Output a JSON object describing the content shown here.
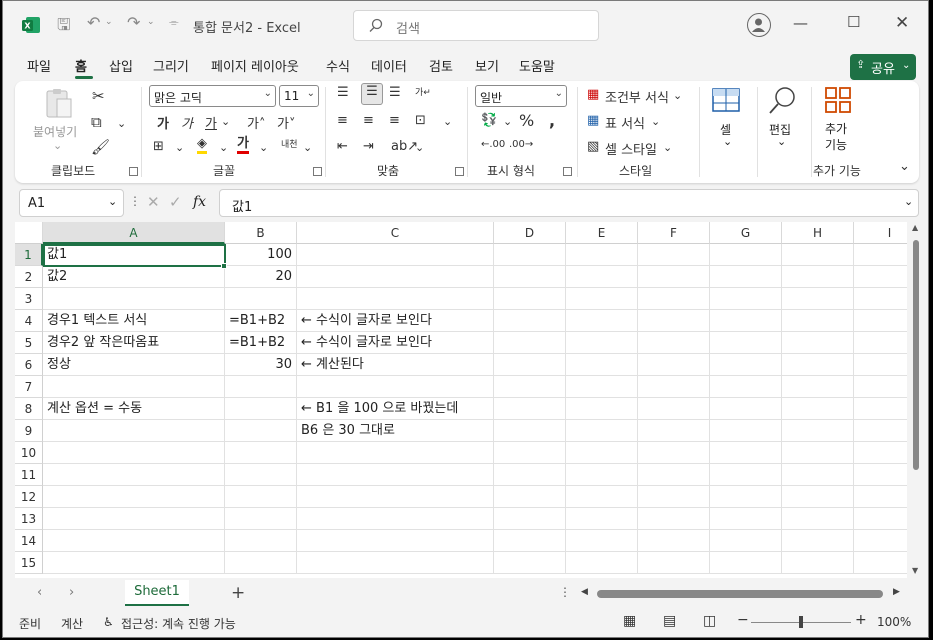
{
  "titlebar": {
    "doc_title": "통합 문서2  -  Excel",
    "search_placeholder": "검색"
  },
  "menu": {
    "tabs": [
      "파일",
      "홈",
      "삽입",
      "그리기",
      "페이지 레이아웃",
      "수식",
      "데이터",
      "검토",
      "보기",
      "도움말"
    ],
    "active_tab": "홈",
    "share_label": "공유"
  },
  "ribbon": {
    "clipboard": {
      "paste": "붙여넣기",
      "label": "클립보드"
    },
    "font": {
      "name": "맑은 고딕",
      "size": "11",
      "bold": "가",
      "italic": "가",
      "underline": "가",
      "font_color": "가",
      "phonetic": "내천",
      "label": "글꼴"
    },
    "alignment": {
      "label": "맞춤"
    },
    "number": {
      "format": "일반",
      "label": "표시 형식"
    },
    "styles": {
      "conditional": "조건부 서식",
      "table": "표 서식",
      "cell_styles": "셀 스타일",
      "label": "스타일"
    },
    "cells": {
      "label": "셀"
    },
    "editing": {
      "label": "편집"
    },
    "addins": {
      "button": "추가\n기능",
      "label": "추가 기능"
    }
  },
  "formula_bar": {
    "name_box": "A1",
    "formula": "값1"
  },
  "grid": {
    "columns": [
      "A",
      "B",
      "C",
      "D",
      "E",
      "F",
      "G",
      "H",
      "I"
    ],
    "rows": [
      "1",
      "2",
      "3",
      "4",
      "5",
      "6",
      "7",
      "8",
      "9",
      "10",
      "11",
      "12",
      "13",
      "14",
      "15"
    ],
    "cells": {
      "A1": "값1",
      "B1": "100",
      "A2": "값2",
      "B2": "20",
      "A4": "경우1 텍스트 서식",
      "B4": "=B1+B2",
      "C4": "← 수식이 글자로 보인다",
      "A5": "경우2 앞 작은따옴표",
      "B5": "=B1+B2",
      "C5": "← 수식이 글자로 보인다",
      "A6": "정상",
      "B6": "30",
      "C6": "← 계산된다",
      "A8": "계산 옵션 = 수동",
      "C8": "← B1 을 100 으로 바꿨는데",
      "C9": "   B6 은 30 그대로"
    }
  },
  "sheets": [
    "Sheet1"
  ],
  "status": {
    "ready": "준비",
    "calculate": "계산",
    "accessibility": "접근성: 계속 진행 가능",
    "zoom": "100%"
  }
}
